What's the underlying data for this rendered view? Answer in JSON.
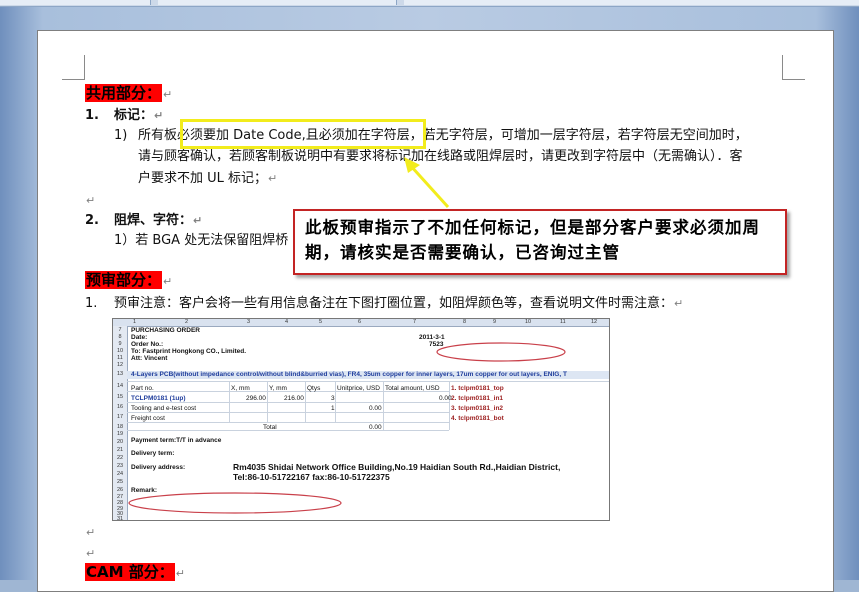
{
  "section1": {
    "heading": "共用部分：",
    "item1_num": "1.",
    "item1_title": "标记：",
    "item1_sub_num": "1)",
    "item1_line1": "所有板必须要加 Date Code,且必须加在字符层，若无字符层，可增加一层字符层，若字符层无空间加时，",
    "item1_line2": "请与顾客确认，若顾客制板说明中有要求将标记加在线路或阻焊层时，请更改到字符层中（无需确认）．客",
    "item1_line3": "户要求不加 UL 标记；",
    "item2_num": "2.",
    "item2_title": "阻焊、字符：",
    "item2_sub": "1）若 BGA 处无法保留阻焊桥"
  },
  "callout": {
    "text": "此板预审指示了不加任何标记，但是部分客户要求必须加周期，请核实是否需要确认，已咨询过主管"
  },
  "section2": {
    "heading": "预审部分：",
    "item1_num": "1.",
    "item1_text": "预审注意：客户会将一些有用信息备注在下图打圈位置，如阻焊颜色等，查看说明文件时需注意："
  },
  "section3": {
    "heading": "CAM 部分："
  },
  "spreadsheet": {
    "col_headers": [
      "1",
      "2",
      "3",
      "4",
      "5",
      "6",
      "7",
      "8",
      "9",
      "10",
      "11",
      "12"
    ],
    "row_numbers": [
      "7",
      "8",
      "9",
      "10",
      "11",
      "12",
      "13",
      "14",
      "15",
      "16",
      "17",
      "18",
      "19",
      "20",
      "21",
      "22",
      "23",
      "24",
      "25",
      "26",
      "27",
      "28",
      "29",
      "30",
      "31"
    ],
    "purchasing_order": "PURCHASING ORDER",
    "date_label": "Date:",
    "date_value": "2011-3-1",
    "order_label": "Order No.:",
    "order_value": "7523",
    "to_line": "To: Fastprint Hongkong CO., Limited.",
    "attn_line": "Att: Vincent",
    "spec_line": "4-Layers PCB(without impedance control/without blind&burried vias), FR4, 35um copper for inner layers, 17um copper for out layers, ENIG, T",
    "table_headers": [
      "Part no.",
      "X, mm",
      "Y, mm",
      "Qtys",
      "Unitprice, USD",
      "Total amount, USD"
    ],
    "row_part": [
      "TCLPM0181 (1up)",
      "296.00",
      "216.00",
      "3",
      "",
      "0.00"
    ],
    "row_tooling": [
      "Tooling and e-test cost",
      "",
      "",
      "1",
      "0.00",
      ""
    ],
    "row_freight": "Freight cost",
    "total_label": "Total",
    "total_value": "0.00",
    "layers": [
      "1. tclpm0181_top",
      "2. tclpm0181_in1",
      "3. tclpm0181_in2",
      "4. tclpm0181_bot"
    ],
    "payment": "Payment term:T/T in advance",
    "delivery_term": "Delivery term:",
    "delivery_address_label": "Delivery address:",
    "delivery_address": "Rm4035 Shidai Network Office Building,No.19 Haidian South Rd.,Haidian District,",
    "tel": "Tel:86-10-51722167 fax:86-10-51722375",
    "remark": "Remark:"
  }
}
